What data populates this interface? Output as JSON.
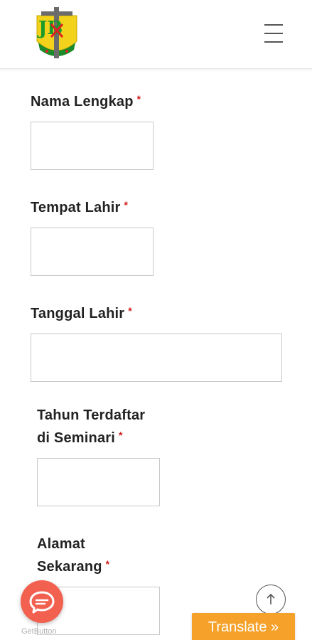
{
  "header": {
    "logo_text": "JB",
    "menu_icon": "hamburger-menu-icon"
  },
  "form": {
    "fields": [
      {
        "label": "Nama Lengkap",
        "required_mark": "*",
        "value": ""
      },
      {
        "label": "Tempat Lahir",
        "required_mark": "*",
        "value": ""
      },
      {
        "label": "Tanggal Lahir",
        "required_mark": "*",
        "value": ""
      },
      {
        "label_line1": "Tahun Terdaftar",
        "label_line2": "di Seminari",
        "required_mark": "*",
        "value": ""
      },
      {
        "label_line1": "Alamat",
        "label_line2": "Sekarang",
        "required_mark": "*",
        "value": ""
      }
    ]
  },
  "floating": {
    "chat_icon": "chat-bubble-icon",
    "getbutton_label": "GetButton",
    "scroll_top_icon": "arrow-up-icon",
    "translate_label": "Translate »"
  },
  "colors": {
    "required": "#d11a1a",
    "chat_button": "#f2604f",
    "translate_button": "#f5a12a"
  }
}
